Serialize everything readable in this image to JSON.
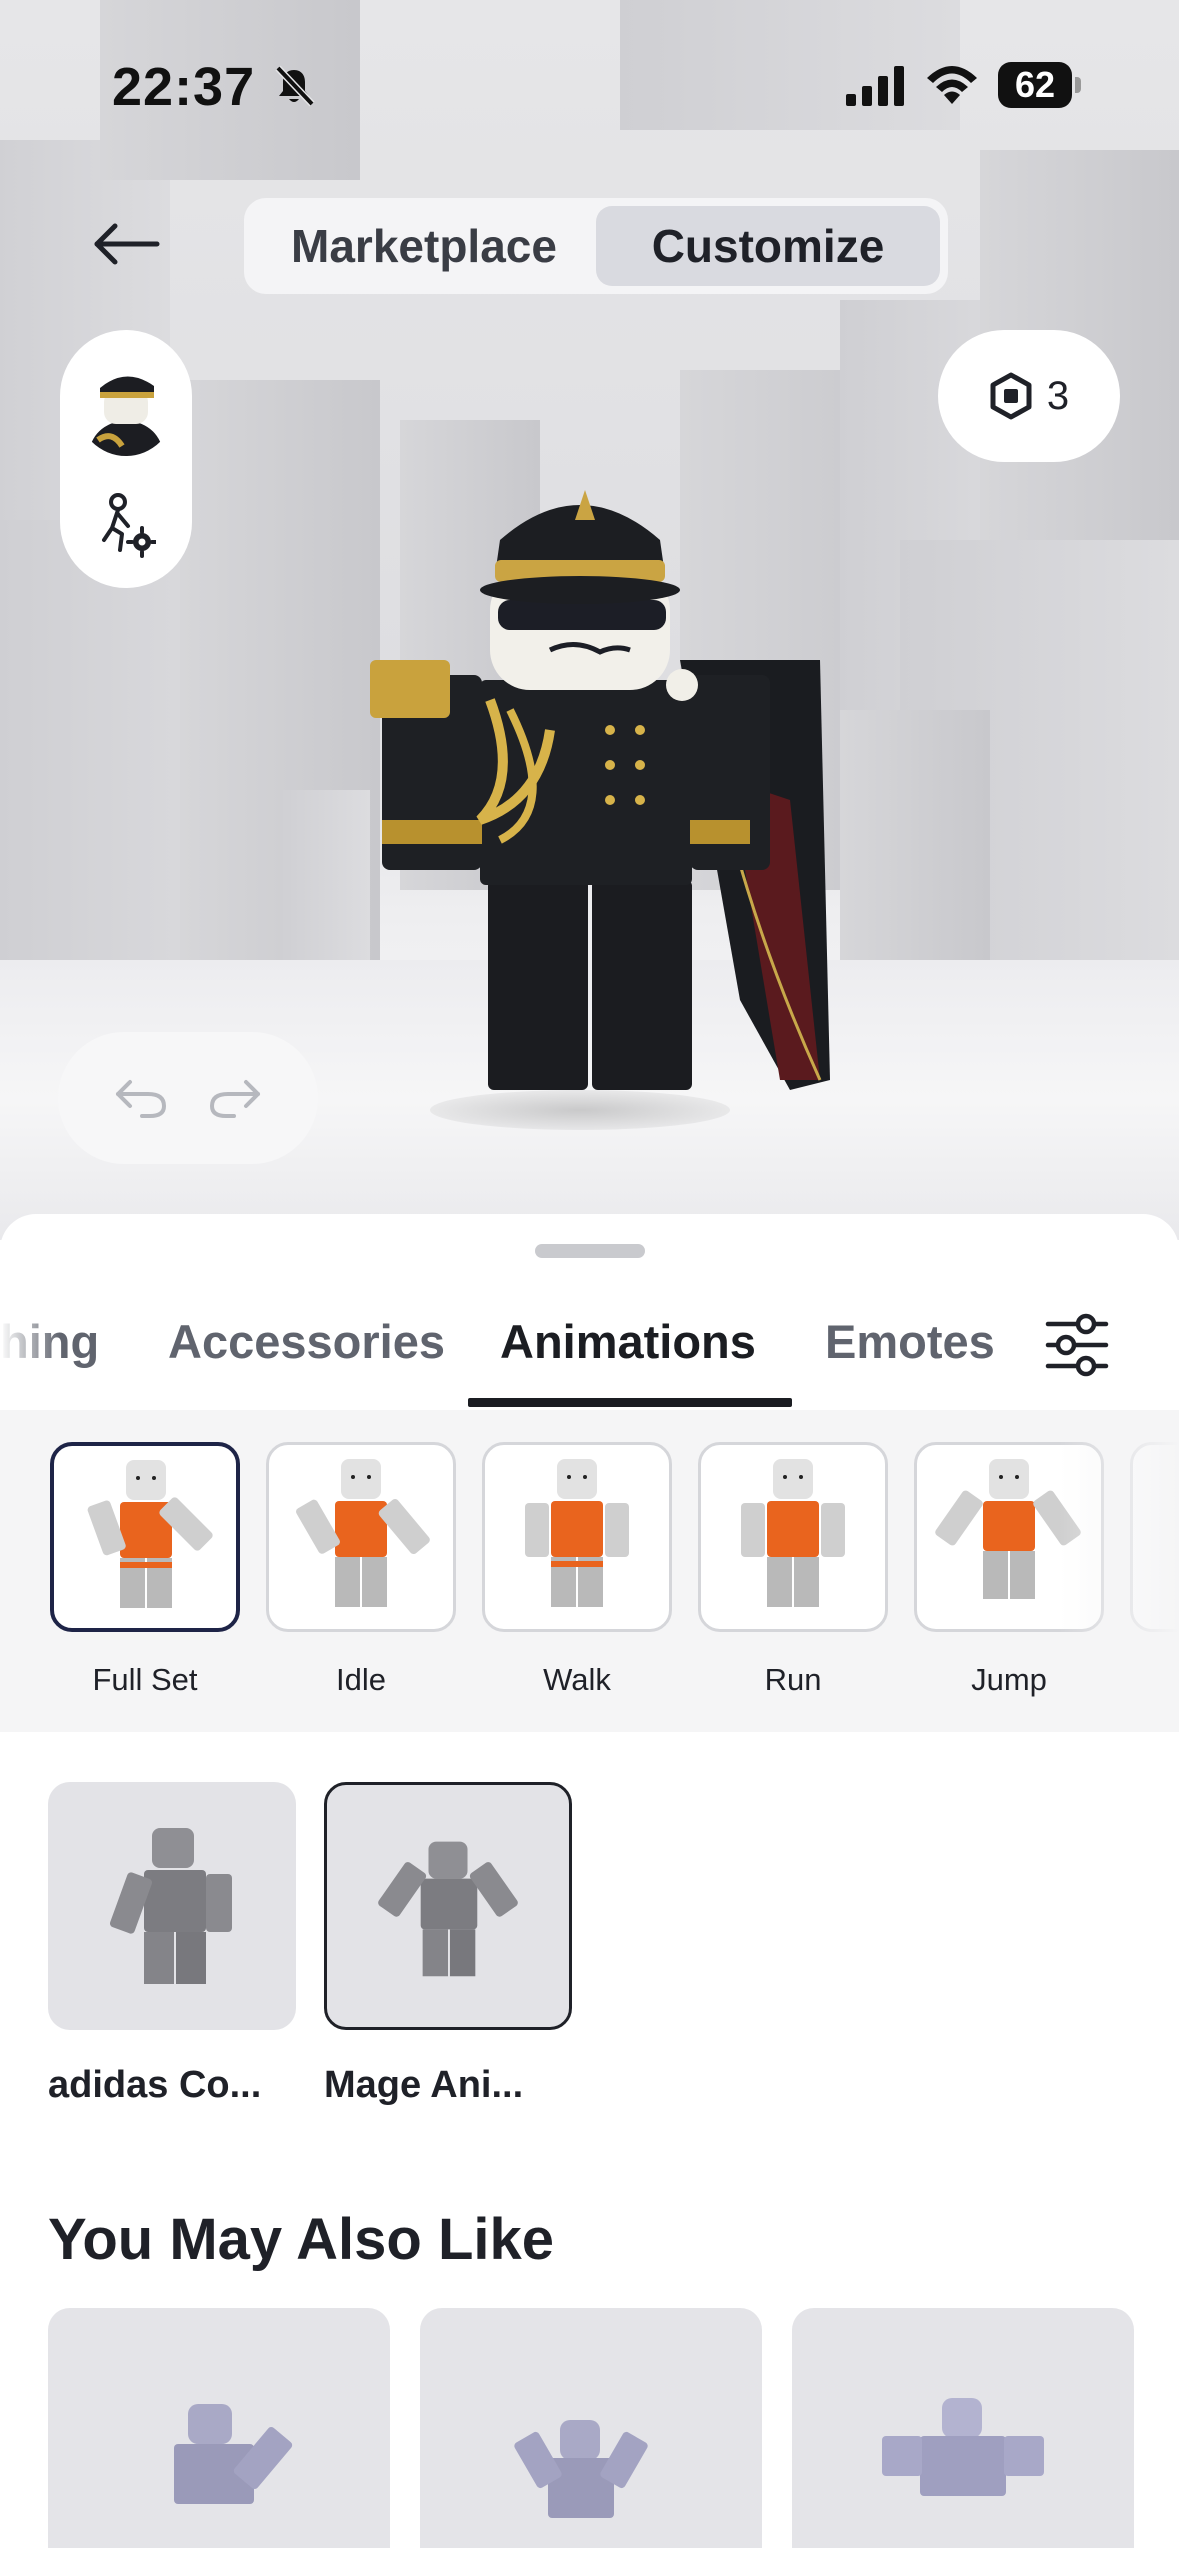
{
  "status_bar": {
    "time": "22:37",
    "battery": "62",
    "icons": [
      "bell-slash-icon",
      "cellular-signal-icon",
      "wifi-icon",
      "battery-icon"
    ]
  },
  "header": {
    "segments": [
      {
        "label": "Marketplace",
        "active": false
      },
      {
        "label": "Customize",
        "active": true
      }
    ]
  },
  "robux": {
    "count": "3",
    "icon": "robux-hexagon-icon"
  },
  "category_tabs": [
    {
      "label": "hing",
      "active": false
    },
    {
      "label": "Accessories",
      "active": false
    },
    {
      "label": "Animations",
      "active": true
    },
    {
      "label": "Emotes",
      "active": false
    }
  ],
  "animation_types": [
    {
      "label": "Full Set",
      "selected": true
    },
    {
      "label": "Idle",
      "selected": false
    },
    {
      "label": "Walk",
      "selected": false
    },
    {
      "label": "Run",
      "selected": false
    },
    {
      "label": "Jump",
      "selected": false
    }
  ],
  "owned_items": [
    {
      "label": "adidas Co...",
      "selected": false
    },
    {
      "label": "Mage Ani...",
      "selected": true
    }
  ],
  "you_may_also_like": {
    "title": "You May Also Like"
  },
  "colors": {
    "accent_selected": "#1e2447",
    "text_primary": "#1f2128",
    "text_secondary": "#60646e",
    "avatar_torso_orange": "#e9641e"
  }
}
